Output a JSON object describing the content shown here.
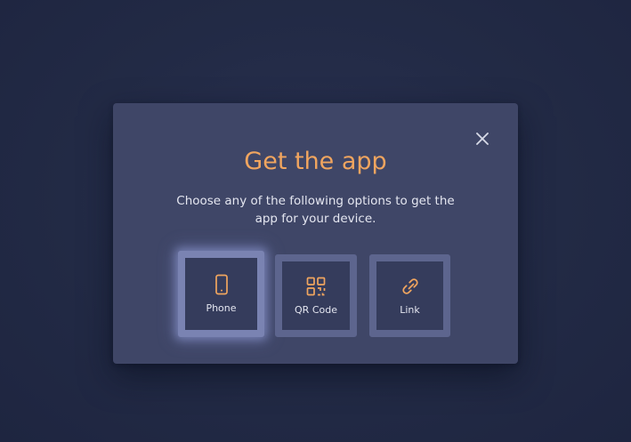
{
  "modal": {
    "title": "Get the app",
    "subtitle": "Choose any of the following options to get the app for your device.",
    "close_icon": "close-icon"
  },
  "options": [
    {
      "label": "Phone",
      "icon": "phone-icon",
      "selected": true
    },
    {
      "label": "QR Code",
      "icon": "qr-code-icon",
      "selected": false
    },
    {
      "label": "Link",
      "icon": "link-icon",
      "selected": false
    }
  ],
  "colors": {
    "accent": "#f0a55f",
    "modal_bg": "#3f4667",
    "page_bg": "#232a45",
    "option_border": "#5d658e",
    "option_bg": "#353c5c",
    "text": "#e4e6f0"
  }
}
